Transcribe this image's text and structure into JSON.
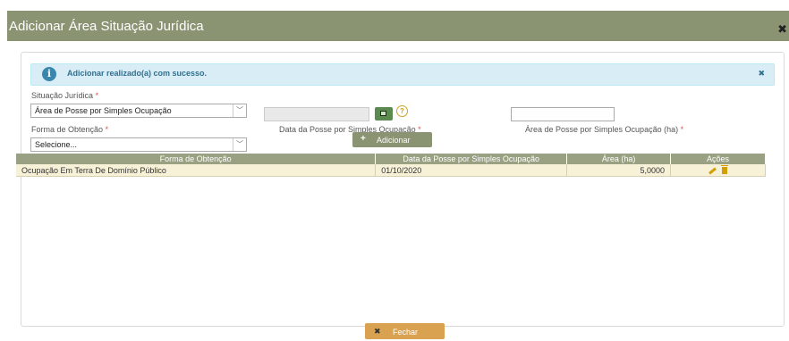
{
  "modal": {
    "title": "Adicionar Área Situação Jurídica",
    "close_icon": "✖"
  },
  "alert": {
    "icon": "i",
    "message": "Adicionar realizado(a) com sucesso.",
    "close_icon": "✖"
  },
  "form": {
    "situacao_label": "Situação Jurídica",
    "situacao_value": "Área de Posse por Simples Ocupação",
    "forma_label": "Forma de Obtenção",
    "forma_value": "Selecione...",
    "data_label": "Data da Posse por Simples Ocupação",
    "area_label": "Área de Posse por Simples Ocupação (ha)",
    "required_mark": "*",
    "help_icon": "?",
    "add_button": "Adicionar",
    "add_icon": "+"
  },
  "table": {
    "headers": [
      "Forma de Obtenção",
      "Data da Posse por Simples Ocupação",
      "Área (ha)",
      "Ações"
    ],
    "rows": [
      {
        "forma": "Ocupação Em Terra De Domínio Público",
        "data": "01/10/2020",
        "area": "5,0000"
      }
    ]
  },
  "footer": {
    "close_button": "Fechar",
    "close_icon": "✖"
  },
  "colors": {
    "header_bg": "#8a9473",
    "alert_bg": "#d9edf7",
    "table_header_bg": "#9aa183",
    "row_bg": "#f6f1d7",
    "close_btn_bg": "#d9a251"
  }
}
